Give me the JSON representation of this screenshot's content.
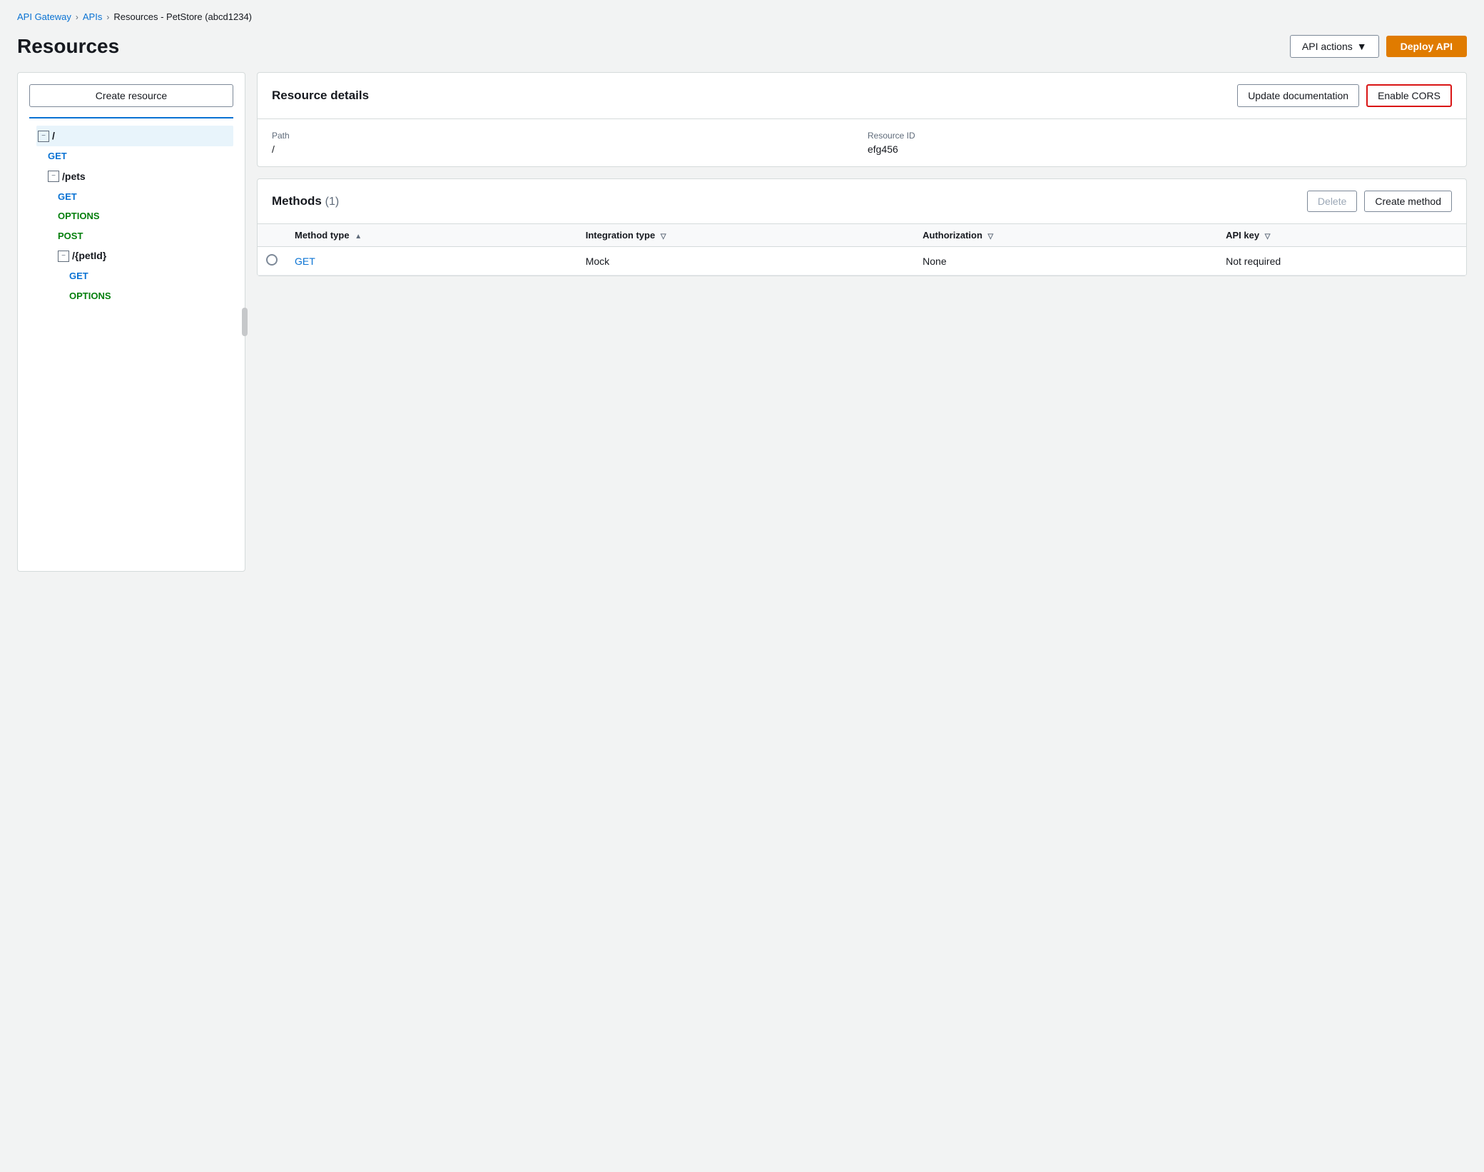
{
  "breadcrumb": {
    "items": [
      {
        "label": "API Gateway",
        "link": true
      },
      {
        "label": "APIs",
        "link": true
      },
      {
        "label": "Resources - PetStore (abcd1234)",
        "link": false
      }
    ]
  },
  "page": {
    "title": "Resources"
  },
  "header": {
    "api_actions_label": "API actions",
    "deploy_label": "Deploy API"
  },
  "sidebar": {
    "create_resource_label": "Create resource",
    "tree": [
      {
        "level": 1,
        "type": "resource",
        "label": "/",
        "expanded": true,
        "selected": true
      },
      {
        "level": 2,
        "type": "method",
        "label": "GET",
        "method": "get"
      },
      {
        "level": 2,
        "type": "resource",
        "label": "/pets",
        "expanded": true
      },
      {
        "level": 3,
        "type": "method",
        "label": "GET",
        "method": "get"
      },
      {
        "level": 3,
        "type": "method",
        "label": "OPTIONS",
        "method": "options"
      },
      {
        "level": 3,
        "type": "method",
        "label": "POST",
        "method": "post"
      },
      {
        "level": 3,
        "type": "resource",
        "label": "/{petId}",
        "expanded": true
      },
      {
        "level": 4,
        "type": "method",
        "label": "GET",
        "method": "get"
      },
      {
        "level": 4,
        "type": "method",
        "label": "OPTIONS",
        "method": "options"
      }
    ]
  },
  "resource_details": {
    "title": "Resource details",
    "update_doc_label": "Update documentation",
    "enable_cors_label": "Enable CORS",
    "path_label": "Path",
    "path_value": "/",
    "resource_id_label": "Resource ID",
    "resource_id_value": "efg456"
  },
  "methods": {
    "title": "Methods",
    "count": "(1)",
    "delete_label": "Delete",
    "create_method_label": "Create method",
    "columns": [
      {
        "label": "Method type",
        "sort": "asc"
      },
      {
        "label": "Integration type",
        "sort": "desc"
      },
      {
        "label": "Authorization",
        "sort": "desc"
      },
      {
        "label": "API key",
        "sort": "desc"
      }
    ],
    "rows": [
      {
        "method_type": "GET",
        "method_link": true,
        "integration_type": "Mock",
        "authorization": "None",
        "api_key": "Not required"
      }
    ]
  }
}
